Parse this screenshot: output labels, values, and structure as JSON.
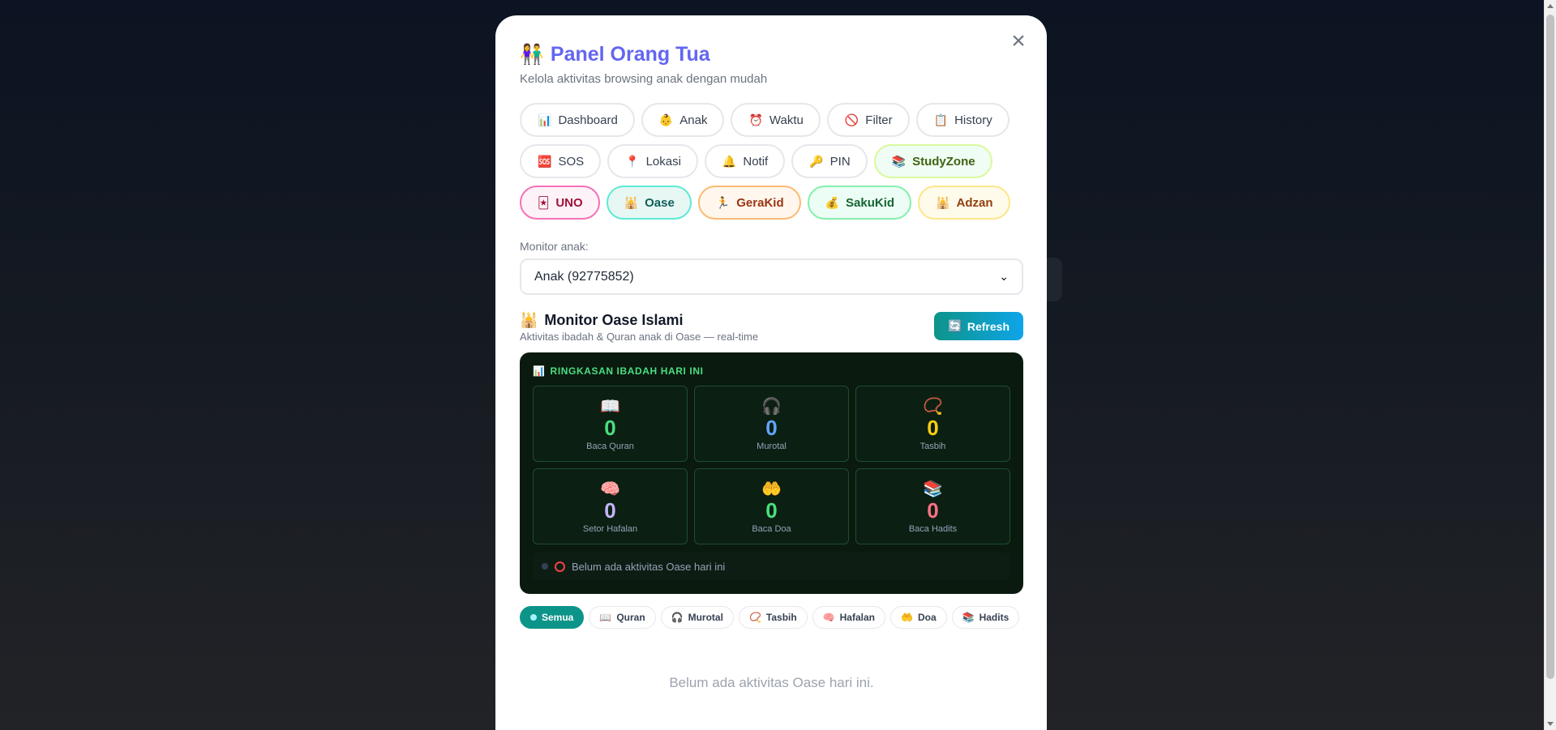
{
  "header": {
    "emoji": "👫",
    "title": "Panel Orang Tua",
    "subtitle": "Kelola aktivitas browsing anak dengan mudah",
    "close": "×"
  },
  "tabs": [
    {
      "key": "dashboard",
      "icon": "📊",
      "label": "Dashboard"
    },
    {
      "key": "anak",
      "icon": "👶",
      "label": "Anak"
    },
    {
      "key": "waktu",
      "icon": "⏰",
      "label": "Waktu"
    },
    {
      "key": "filter",
      "icon": "🚫",
      "label": "Filter"
    },
    {
      "key": "history",
      "icon": "📋",
      "label": "History"
    },
    {
      "key": "sos",
      "icon": "🆘",
      "label": "SOS"
    },
    {
      "key": "lokasi",
      "icon": "📍",
      "label": "Lokasi"
    },
    {
      "key": "notif",
      "icon": "🔔",
      "label": "Notif"
    },
    {
      "key": "pin",
      "icon": "🔑",
      "label": "PIN"
    },
    {
      "key": "studyzone",
      "icon": "📚",
      "label": "StudyZone"
    },
    {
      "key": "uno",
      "icon": "🃏",
      "label": "UNO"
    },
    {
      "key": "oase",
      "icon": "🕌",
      "label": "Oase"
    },
    {
      "key": "gerakid",
      "icon": "🏃",
      "label": "GeraKid"
    },
    {
      "key": "sakukid",
      "icon": "💰",
      "label": "SakuKid"
    },
    {
      "key": "adzan",
      "icon": "🕌",
      "label": "Adzan"
    }
  ],
  "monitor": {
    "label": "Monitor anak:",
    "selected": "Anak (92775852)"
  },
  "section": {
    "emoji": "🕌",
    "title": "Monitor Oase Islami",
    "subtitle": "Aktivitas ibadah & Quran anak di Oase — real-time",
    "refresh_icon": "🔄",
    "refresh_label": "Refresh"
  },
  "summary": {
    "icon": "📊",
    "title": "RINGKASAN IBADAH HARI INI",
    "stats": [
      {
        "emoji": "📖",
        "value": "0",
        "label": "Baca Quran",
        "color": "#4ade80"
      },
      {
        "emoji": "🎧",
        "value": "0",
        "label": "Murotal",
        "color": "#60a5fa"
      },
      {
        "emoji": "📿",
        "value": "0",
        "label": "Tasbih",
        "color": "#facc15"
      },
      {
        "emoji": "🧠",
        "value": "0",
        "label": "Setor Hafalan",
        "color": "#c4b5fd"
      },
      {
        "emoji": "🤲",
        "value": "0",
        "label": "Baca Doa",
        "color": "#4ade80"
      },
      {
        "emoji": "📚",
        "value": "0",
        "label": "Baca Hadits",
        "color": "#fb7185"
      }
    ],
    "empty_text": "Belum ada aktivitas Oase hari ini"
  },
  "filters": [
    {
      "icon": "",
      "label": "Semua",
      "active": true
    },
    {
      "icon": "📖",
      "label": "Quran"
    },
    {
      "icon": "🎧",
      "label": "Murotal"
    },
    {
      "icon": "📿",
      "label": "Tasbih"
    },
    {
      "icon": "🧠",
      "label": "Hafalan"
    },
    {
      "icon": "🤲",
      "label": "Doa"
    },
    {
      "icon": "📚",
      "label": "Hadits"
    }
  ],
  "empty_message": "Belum ada aktivitas Oase hari ini."
}
